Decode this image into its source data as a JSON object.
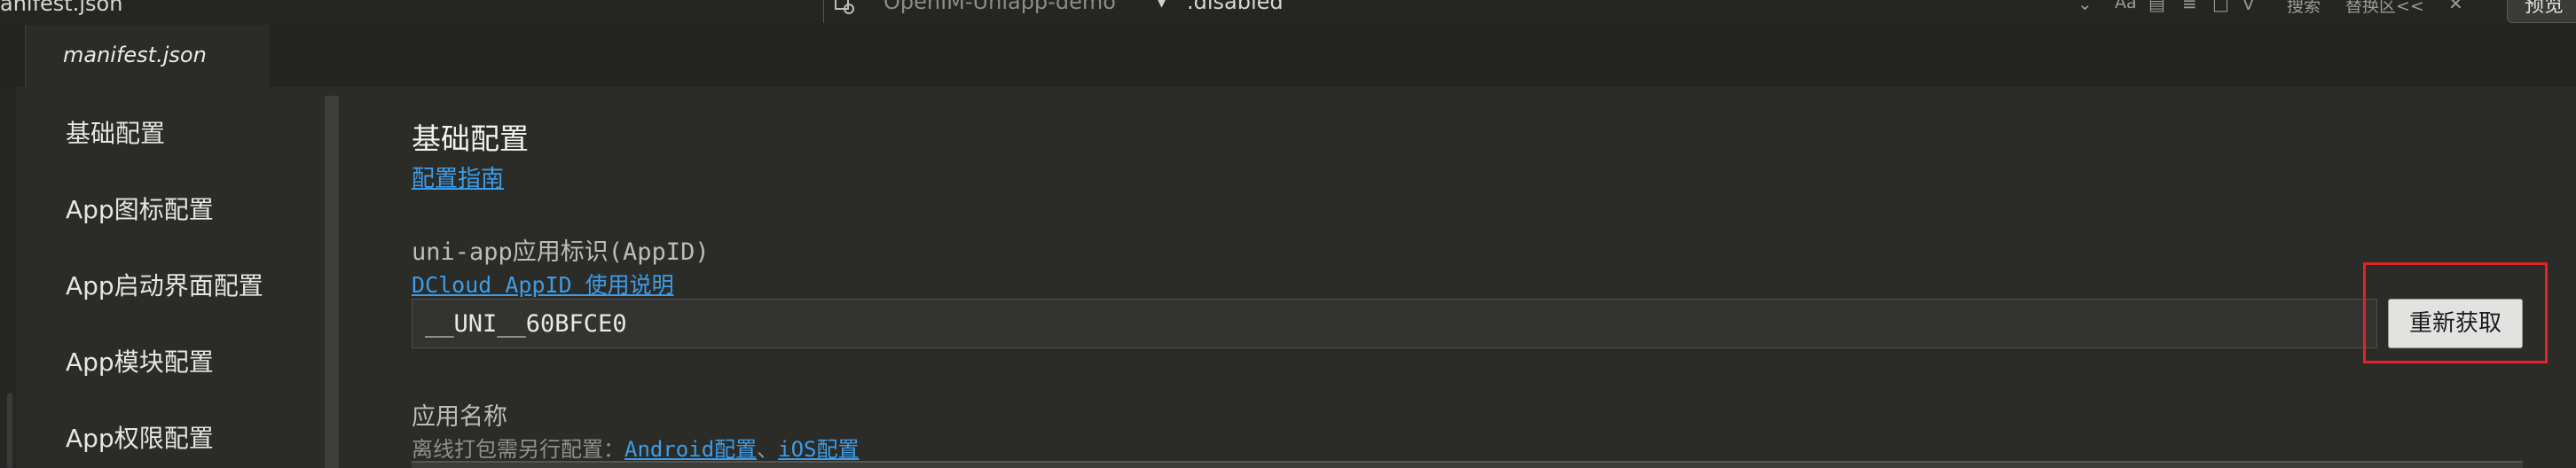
{
  "toolbar": {
    "file_title": "anifest.json",
    "project_name": "OpenIM-Uniapp-demo",
    "filter_text": ".disabled",
    "match_case_label": "Aa",
    "search_label": "搜索",
    "replace_label": "替换区<<",
    "preview_label": "预览"
  },
  "tab": {
    "label": "manifest.json"
  },
  "sidebar": {
    "items": [
      {
        "label": "基础配置"
      },
      {
        "label": "App图标配置"
      },
      {
        "label": "App启动界面配置"
      },
      {
        "label": "App模块配置"
      },
      {
        "label": "App权限配置"
      }
    ]
  },
  "content": {
    "section_title": "基础配置",
    "guide_link": "配置指南",
    "appid": {
      "label": "uni-app应用标识(AppID)",
      "help_link": "DCloud AppID 使用说明",
      "value": "__UNI__60BFCE0",
      "refetch_label": "重新获取"
    },
    "appname": {
      "label": "应用名称",
      "hint_prefix": "离线打包需另行配置：",
      "android_link": "Android配置",
      "separator": "、",
      "ios_link": "iOS配置"
    }
  },
  "colors": {
    "link": "#3e9ce6",
    "highlight": "#e2242a",
    "background": "#2b2b28"
  }
}
